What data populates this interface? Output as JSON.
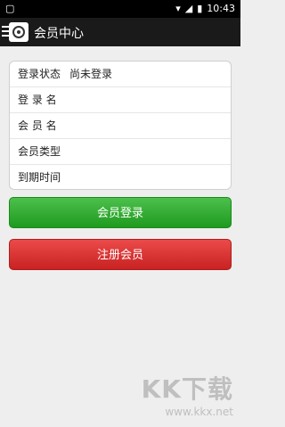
{
  "status_bar": {
    "time": "10:43"
  },
  "app_bar": {
    "title": "会员中心"
  },
  "info_rows": [
    {
      "label": "登录状态",
      "value": "尚未登录"
    },
    {
      "label": "登 录 名",
      "value": ""
    },
    {
      "label": "会 员 名",
      "value": ""
    },
    {
      "label": "会员类型",
      "value": ""
    },
    {
      "label": "到期时间",
      "value": ""
    }
  ],
  "buttons": {
    "login": "会员登录",
    "register": "注册会员"
  },
  "watermark": {
    "brand": "KK下载",
    "url": "www.kkx.net"
  },
  "colors": {
    "login": "#2ea82e",
    "register": "#d93333",
    "app_bar": "#1a1a1a"
  }
}
